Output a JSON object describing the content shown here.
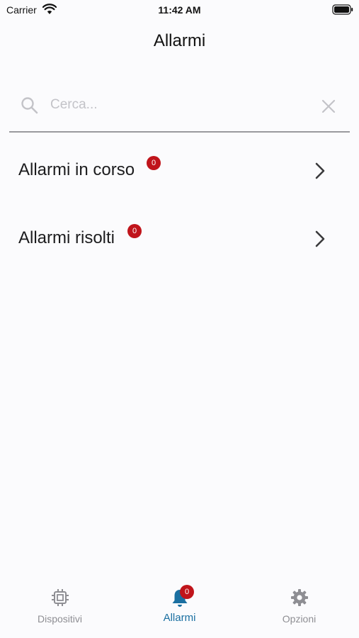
{
  "status_bar": {
    "carrier": "Carrier",
    "time": "11:42 AM"
  },
  "header": {
    "title": "Allarmi"
  },
  "search": {
    "placeholder": "Cerca...",
    "value": ""
  },
  "list": {
    "items": [
      {
        "label": "Allarmi in corso",
        "badge": "0"
      },
      {
        "label": "Allarmi risolti",
        "badge": "0"
      }
    ]
  },
  "tab_bar": {
    "tabs": [
      {
        "label": "Dispositivi",
        "icon": "chip-icon"
      },
      {
        "label": "Allarmi",
        "icon": "bell-icon",
        "badge": "0",
        "selected": true
      },
      {
        "label": "Opzioni",
        "icon": "gear-icon"
      }
    ]
  },
  "colors": {
    "accent": "#1a6fa1",
    "badge": "#c0141b",
    "inactive": "#8e8e93",
    "background": "#fbfbfd"
  }
}
